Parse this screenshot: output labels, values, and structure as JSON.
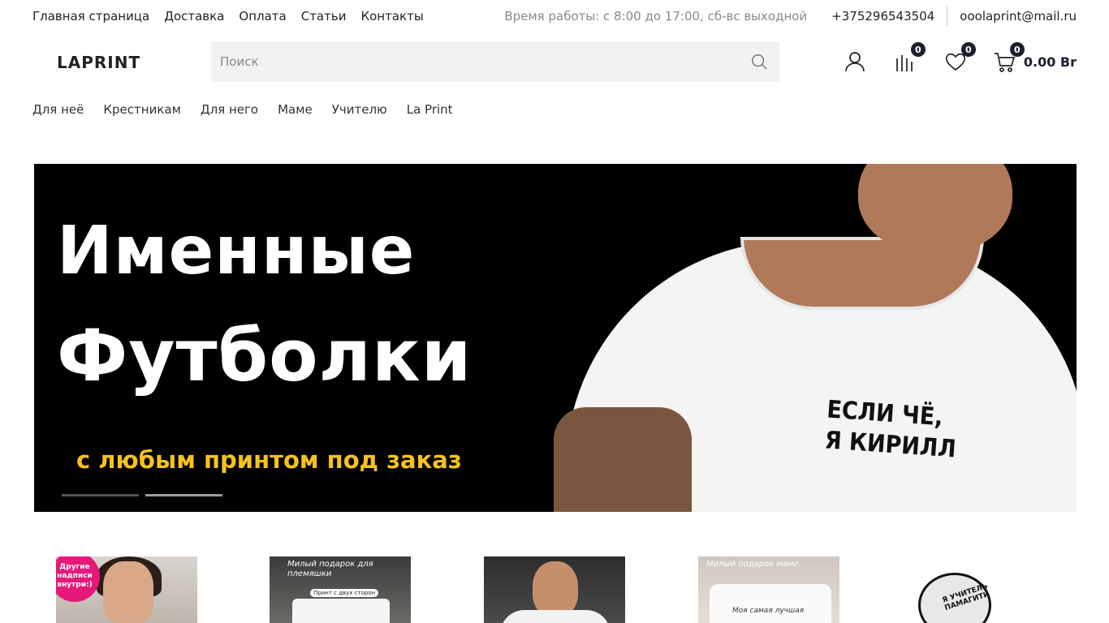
{
  "topbar": {
    "nav": [
      "Главная страница",
      "Доставка",
      "Оплата",
      "Статьи",
      "Контакты"
    ],
    "hours": "Время работы: с 8:00 до 17:00, сб-вс выходной",
    "phone": "+375296543504",
    "email": "ooolaprint@mail.ru"
  },
  "header": {
    "logo": "LAPRINT",
    "search_placeholder": "Поиск",
    "compare_count": "0",
    "favorites_count": "0",
    "cart_count": "0",
    "cart_total": "0.00 Br"
  },
  "categories": [
    "Для неё",
    "Крестникам",
    "Для него",
    "Маме",
    "Учителю",
    "La Print"
  ],
  "banner": {
    "title_line1": "Именные",
    "title_line2": "Футболки",
    "subtitle": "с любым принтом под заказ",
    "shirt_print_line1": "ЕСЛИ ЧЁ,",
    "shirt_print_line2": "Я КИРИЛЛ",
    "slides": 2,
    "active_slide": 2
  },
  "products": [
    {
      "badge": "Другие надписи внутри:)"
    },
    {
      "title": "Милый подарок для племяшки",
      "note": "Принт с двух сторон"
    },
    {},
    {
      "title": "Милый подарок маме",
      "text": "Моя самая лучшая"
    },
    {
      "text": "Я УЧИТЕЛЬ ПАМАГИТИ"
    }
  ],
  "colors": {
    "badge_bg": "#1b1f2e",
    "banner_accent": "#f7c21a",
    "tag_pink": "#e6187a"
  }
}
